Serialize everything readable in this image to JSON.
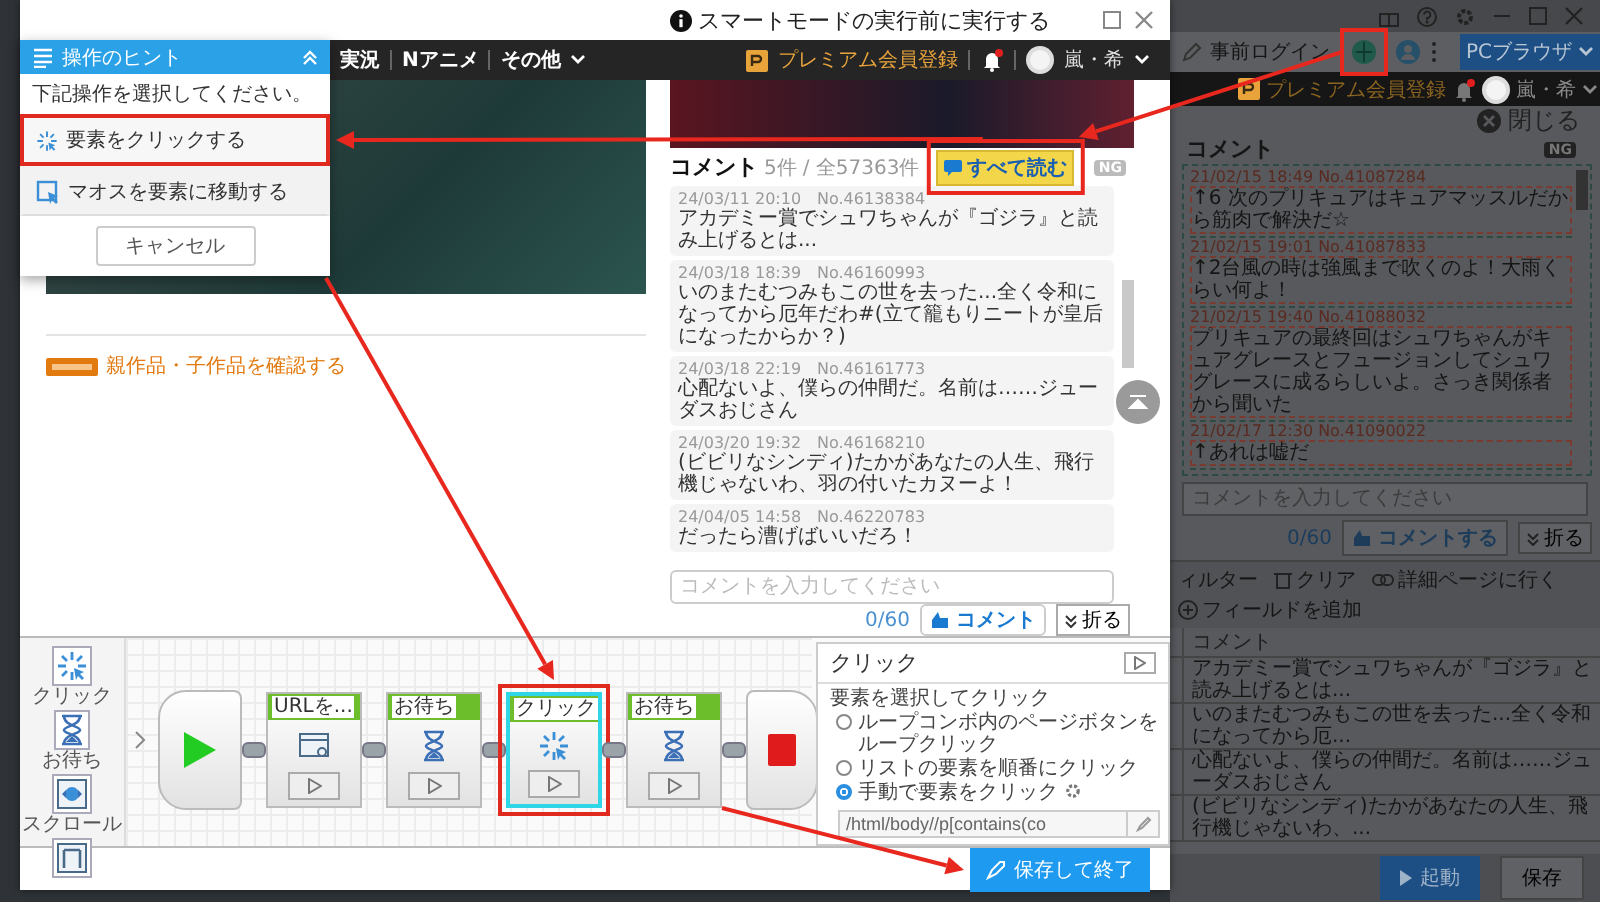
{
  "dialog": {
    "title": "スマートモードの実行前に実行する"
  },
  "site_header": {
    "nav": [
      "実況",
      "Nアニメ",
      "その他"
    ],
    "premium": "プレミアム会員登録",
    "user": "嵐・希"
  },
  "related_link": "親作品・子作品を確認する",
  "comments": {
    "title": "コメント",
    "count": "5件",
    "total": "/ 全57363件",
    "read_all": "すべて読む",
    "ng_label": "NG",
    "items": [
      {
        "meta": "24/03/11 20:10　No.46138384",
        "text": "アカデミー賞でシュワちゃんが『ゴジラ』と読み上げるとは..."
      },
      {
        "meta": "24/03/18 18:39　No.46160993",
        "text": "いのまたむつみもこの世を去った...全く令和になってから厄年だわ#(立て籠もりニートが皇后になったからか？)"
      },
      {
        "meta": "24/03/18 22:19　No.46161773",
        "text": "心配ないよ、僕らの仲間だ。名前は……ジューダスおじさん"
      },
      {
        "meta": "24/03/20 19:32　No.46168210",
        "text": "(ビビリなシンディ)たかがあなたの人生、飛行機じゃないわ、羽の付いたカヌーよ！"
      },
      {
        "meta": "24/04/05 14:58　No.46220783",
        "text": "だったら漕げばいいだろ！"
      }
    ],
    "placeholder": "コメントを入力してください",
    "counter": "0/60",
    "submit": "コメント",
    "collapse": "折る"
  },
  "hint_panel": {
    "title": "操作のヒント",
    "prompt": "下記操作を選択してください。",
    "options": [
      {
        "kind": "click",
        "label": "要素をクリックする",
        "selected": true
      },
      {
        "kind": "hover",
        "label": "マオスを要素に移動する",
        "selected": false
      }
    ],
    "cancel": "キャンセル"
  },
  "palette": [
    {
      "kind": "click",
      "label": "クリック"
    },
    {
      "kind": "wait",
      "label": "お待ち"
    },
    {
      "kind": "scroll",
      "label": "スクロール"
    },
    {
      "kind": "page"
    }
  ],
  "flow": {
    "steps": [
      {
        "kind": "open-url",
        "label": "URLを...",
        "selected": false
      },
      {
        "kind": "wait",
        "label": "お待ち",
        "selected": false
      },
      {
        "kind": "click",
        "label": "クリック",
        "selected": true
      },
      {
        "kind": "wait",
        "label": "お待ち",
        "selected": false
      }
    ]
  },
  "step_settings": {
    "title": "クリック",
    "heading": "要素を選択してクリック",
    "options": [
      {
        "label": "ループコンボ内のページボタンをループクリック",
        "selected": false
      },
      {
        "label": "リストの要素を順番にクリック",
        "selected": false
      },
      {
        "label": "手動で要素をクリック",
        "selected": true
      }
    ],
    "xpath": "/html/body//p[contains(co"
  },
  "save_button": "保存して終了",
  "background_app": {
    "login": "事前ログイン",
    "browser_button": "PCブラウザ",
    "premium": "プレミアム会員登録",
    "user": "嵐・希",
    "close": "閉じる",
    "comments_title": "コメント",
    "ng_label": "NG",
    "comments": [
      {
        "meta": "21/02/15 18:49 No.41087284",
        "text": "↑6 次のプリキュアはキュアマッスルだから筋肉で解決だ☆"
      },
      {
        "meta": "21/02/15 19:01 No.41087833",
        "text": "↑2台風の時は強風まで吹くのよ！大雨くらい何よ！"
      },
      {
        "meta": "21/02/15 19:40 No.41088032",
        "text": "プリキュアの最終回はシュワちゃんがキュアグレースとフュージョンしてシュワグレースに成るらしいよ。さっき関係者から聞いた"
      },
      {
        "meta": "21/02/17 12:30 No.41090022",
        "text": "↑あれは嘘だ"
      }
    ],
    "placeholder": "コメントを入力してください",
    "counter": "0/60",
    "submit": "コメントする",
    "collapse": "折る",
    "toolbar": [
      "ィルター",
      "クリア",
      "詳細ページに行く",
      "フィールドを追加"
    ],
    "table": {
      "columns": [
        "コメント"
      ],
      "rows": [
        [
          "アカデミー賞でシュワちゃんが『ゴジラ』と読み上げるとは..."
        ],
        [
          "いのまたむつみもこの世を去った...全く令和になってから厄..."
        ],
        [
          "心配ないよ、僕らの仲間だ。名前は……ジューダスおじさん"
        ],
        [
          "(ビビリなシンディ)たかがあなたの人生、飛行機じゃないわ、..."
        ]
      ]
    },
    "run": "起動",
    "save": "保存"
  }
}
